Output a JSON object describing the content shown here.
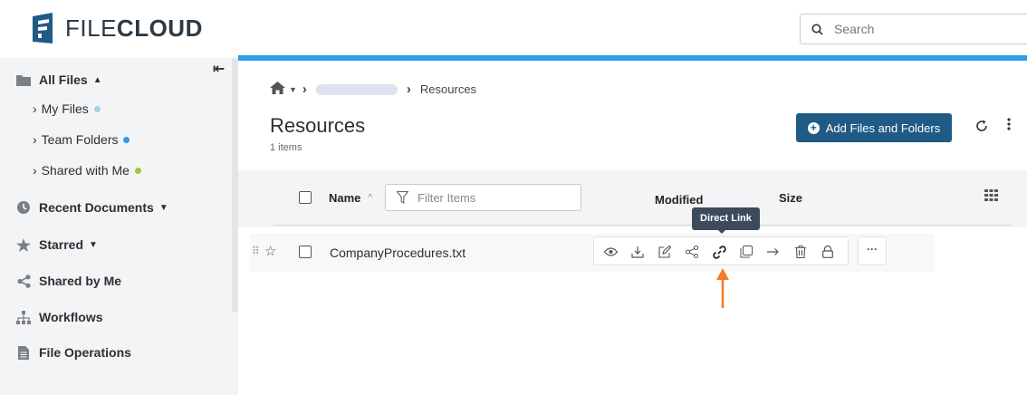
{
  "app": {
    "logo_text_light": "FILE",
    "logo_text_bold": "CLOUD",
    "brand_color": "#1f5b84",
    "accent_color": "#2f9ce8"
  },
  "search": {
    "placeholder": "Search",
    "icon": "search-icon"
  },
  "sidebar": {
    "collapse_icon": "collapse-left-icon",
    "all_files": {
      "label": "All Files",
      "icon": "folder-icon",
      "caret": "▲"
    },
    "sub_items": [
      {
        "label": "My Files",
        "dot_color": "#9fd8de"
      },
      {
        "label": "Team Folders",
        "dot_color": "#2f9ce8"
      },
      {
        "label": "Shared with Me",
        "dot_color": "#9ccc2e"
      }
    ],
    "sub_prefix": "›",
    "items": [
      {
        "label": "Recent Documents",
        "icon": "clock-icon",
        "caret": "▼"
      },
      {
        "label": "Starred",
        "icon": "star-icon",
        "caret": "▼"
      },
      {
        "label": "Shared by Me",
        "icon": "share-icon",
        "caret": ""
      },
      {
        "label": "Workflows",
        "icon": "workflow-icon",
        "caret": ""
      },
      {
        "label": "File Operations",
        "icon": "file-icon",
        "caret": ""
      }
    ]
  },
  "breadcrumb": {
    "home_icon": "home-icon",
    "separator": "›",
    "current": "Resources"
  },
  "main": {
    "title": "Resources",
    "item_count": "1 items",
    "add_button": "Add Files and Folders",
    "refresh_icon": "refresh-icon",
    "more_icon": "kebab-icon"
  },
  "table": {
    "col_name": "Name",
    "sort_indicator": "^",
    "filter_placeholder": "Filter Items",
    "col_modified": "Modified",
    "col_size": "Size",
    "view_icon": "grid-view-icon",
    "rows": [
      {
        "name": "CompanyProcedures.txt"
      }
    ]
  },
  "row_actions": {
    "icons": [
      "view-icon",
      "download-icon",
      "edit-icon",
      "share-icon",
      "direct-link-icon",
      "copy-icon",
      "move-icon",
      "delete-icon",
      "lock-icon"
    ],
    "more_label": "···",
    "tooltip": "Direct Link"
  },
  "annotation": {
    "arrow_color": "#f37b2c"
  }
}
